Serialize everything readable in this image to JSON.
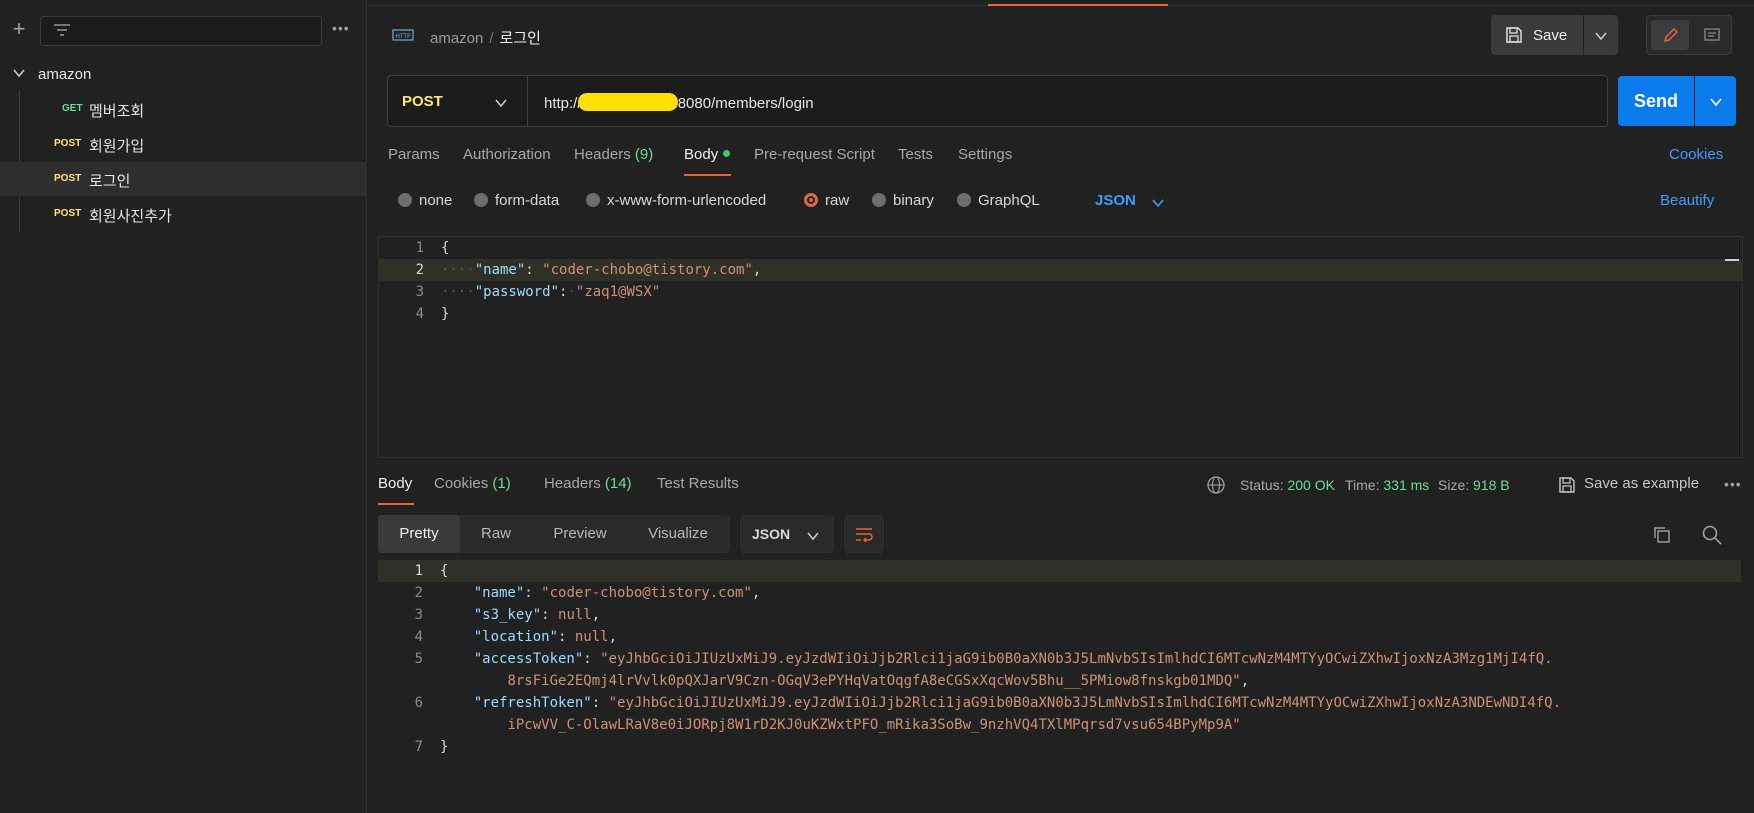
{
  "sidebar": {
    "filter_placeholder": "",
    "more_label": "•••",
    "collection": "amazon",
    "requests": [
      {
        "method": "GET",
        "label": "멤버조회"
      },
      {
        "method": "POST",
        "label": "회원가입"
      },
      {
        "method": "POST",
        "label": "로그인"
      },
      {
        "method": "POST",
        "label": "회원사진추가"
      }
    ]
  },
  "header": {
    "breadcrumb_collection": "amazon",
    "breadcrumb_sep": "/",
    "breadcrumb_request": "로그인",
    "save_label": "Save"
  },
  "request": {
    "method": "POST",
    "url_prefix": "http://",
    "url_suffix": ":8080/members/login",
    "send_label": "Send"
  },
  "request_tabs": {
    "params": "Params",
    "authorization": "Authorization",
    "headers": "Headers",
    "headers_count": "(9)",
    "body": "Body",
    "prerequest": "Pre-request Script",
    "tests": "Tests",
    "settings": "Settings",
    "cookies": "Cookies"
  },
  "body_types": {
    "none": "none",
    "form_data": "form-data",
    "urlencoded": "x-www-form-urlencoded",
    "raw": "raw",
    "binary": "binary",
    "graphql": "GraphQL",
    "format": "JSON",
    "beautify": "Beautify"
  },
  "request_body": {
    "l1": "{",
    "l2_key": "\"name\"",
    "l2_val": "\"coder-chobo@tistory.com\"",
    "l3_key": "\"password\"",
    "l3_val": "\"zaq1@WSX\"",
    "l4": "}"
  },
  "response_tabs": {
    "body": "Body",
    "cookies": "Cookies",
    "cookies_count": "(1)",
    "headers": "Headers",
    "headers_count": "(14)",
    "test_results": "Test Results"
  },
  "response_meta": {
    "status_label": "Status:",
    "status_value": "200 OK",
    "time_label": "Time:",
    "time_value": "331 ms",
    "size_label": "Size:",
    "size_value": "918 B",
    "save_example": "Save as example",
    "more": "•••"
  },
  "response_view": {
    "pretty": "Pretty",
    "raw": "Raw",
    "preview": "Preview",
    "visualize": "Visualize",
    "format": "JSON"
  },
  "response_body": {
    "l1": "{",
    "name_key": "\"name\"",
    "name_val": "\"coder-chobo@tistory.com\"",
    "s3_key": "\"s3_key\"",
    "s3_val": "null",
    "location_key": "\"location\"",
    "location_val": "null",
    "access_key": "\"accessToken\"",
    "access_val_1": "\"eyJhbGciOiJIUzUxMiJ9.eyJzdWIiOiJjb2Rlci1jaG9ib0B0aXN0b3J5LmNvbSIsImlhdCI6MTcwNzM4MTYyOCwiZXhwIjoxNzA3Mzg1MjI4fQ.",
    "access_val_2": "8rsFiGe2EQmj4lrVvlk0pQXJarV9Czn-OGqV3ePYHqVatOqgfA8eCGSxXqcWov5Bhu__5PMiow8fnskgb01MDQ\"",
    "refresh_key": "\"refreshToken\"",
    "refresh_val_1": "\"eyJhbGciOiJIUzUxMiJ9.eyJzdWIiOiJjb2Rlci1jaG9ib0B0aXN0b3J5LmNvbSIsImlhdCI6MTcwNzM4MTYyOCwiZXhwIjoxNzA3NDEwNDI4fQ.",
    "refresh_val_2": "iPcwVV_C-OlawLRaV8e0iJORpj8W1rD2KJ0uKZWxtPFO_mRika3SoBw_9nzhVQ4TXlMPqrsd7vsu654BPyMp9A\"",
    "l7": "}"
  },
  "colors": {
    "accent": "#e8633a",
    "send": "#097bed",
    "get": "#6bdd9a",
    "post": "#ffe47e",
    "link": "#3f9bff"
  }
}
